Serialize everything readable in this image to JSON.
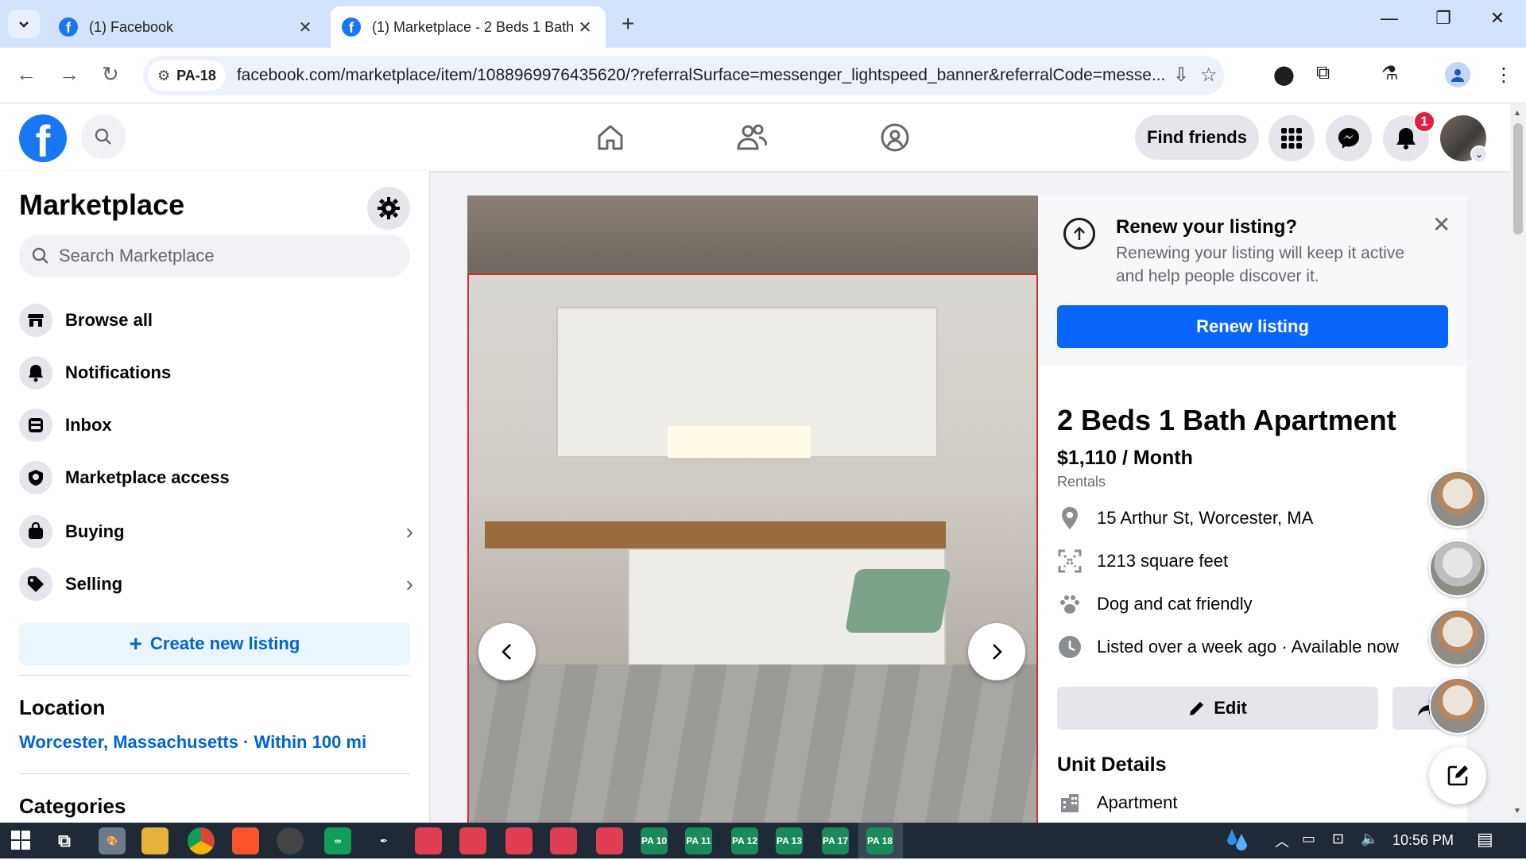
{
  "browser": {
    "tabs": [
      {
        "title": "(1) Facebook",
        "active": false
      },
      {
        "title": "(1) Marketplace - 2 Beds 1 Bath",
        "active": true
      }
    ],
    "site_chip": "PA-18",
    "url": "facebook.com/marketplace/item/1088969976435620/?referralSurface=messenger_lightspeed_banner&referralCode=messe..."
  },
  "header": {
    "find_friends": "Find friends",
    "notification_count": "1"
  },
  "sidebar": {
    "title": "Marketplace",
    "search_placeholder": "Search Marketplace",
    "items": [
      {
        "label": "Browse all",
        "icon": "storefront-icon"
      },
      {
        "label": "Notifications",
        "icon": "bell-icon"
      },
      {
        "label": "Inbox",
        "icon": "inbox-icon"
      },
      {
        "label": "Marketplace access",
        "icon": "shield-icon"
      },
      {
        "label": "Buying",
        "icon": "shopping-bag-icon"
      },
      {
        "label": "Selling",
        "icon": "tag-icon"
      }
    ],
    "create_listing": "Create new listing",
    "location_heading": "Location",
    "location_value": "Worcester, Massachusetts · Within 100 mi",
    "categories_heading": "Categories"
  },
  "renew": {
    "title": "Renew your listing?",
    "text": "Renewing your listing will keep it active and help people discover it.",
    "button": "Renew listing"
  },
  "listing": {
    "title": "2 Beds 1 Bath Apartment",
    "price": "$1,110 / Month",
    "category": "Rentals",
    "details": [
      {
        "icon": "location-pin-icon",
        "text": "15 Arthur St, Worcester, MA"
      },
      {
        "icon": "area-icon",
        "text": "1213 square feet"
      },
      {
        "icon": "paw-icon",
        "text": "Dog and cat friendly"
      },
      {
        "icon": "clock-icon",
        "text": "Listed over a week ago · Available now"
      }
    ],
    "edit_label": "Edit",
    "unit_details_heading": "Unit Details",
    "unit_type": "Apartment"
  },
  "taskbar": {
    "time": "10:56 PM",
    "pinned_labels": [
      "PA 10",
      "PA 11",
      "PA 12",
      "PA 13",
      "PA 17",
      "PA 18"
    ]
  }
}
